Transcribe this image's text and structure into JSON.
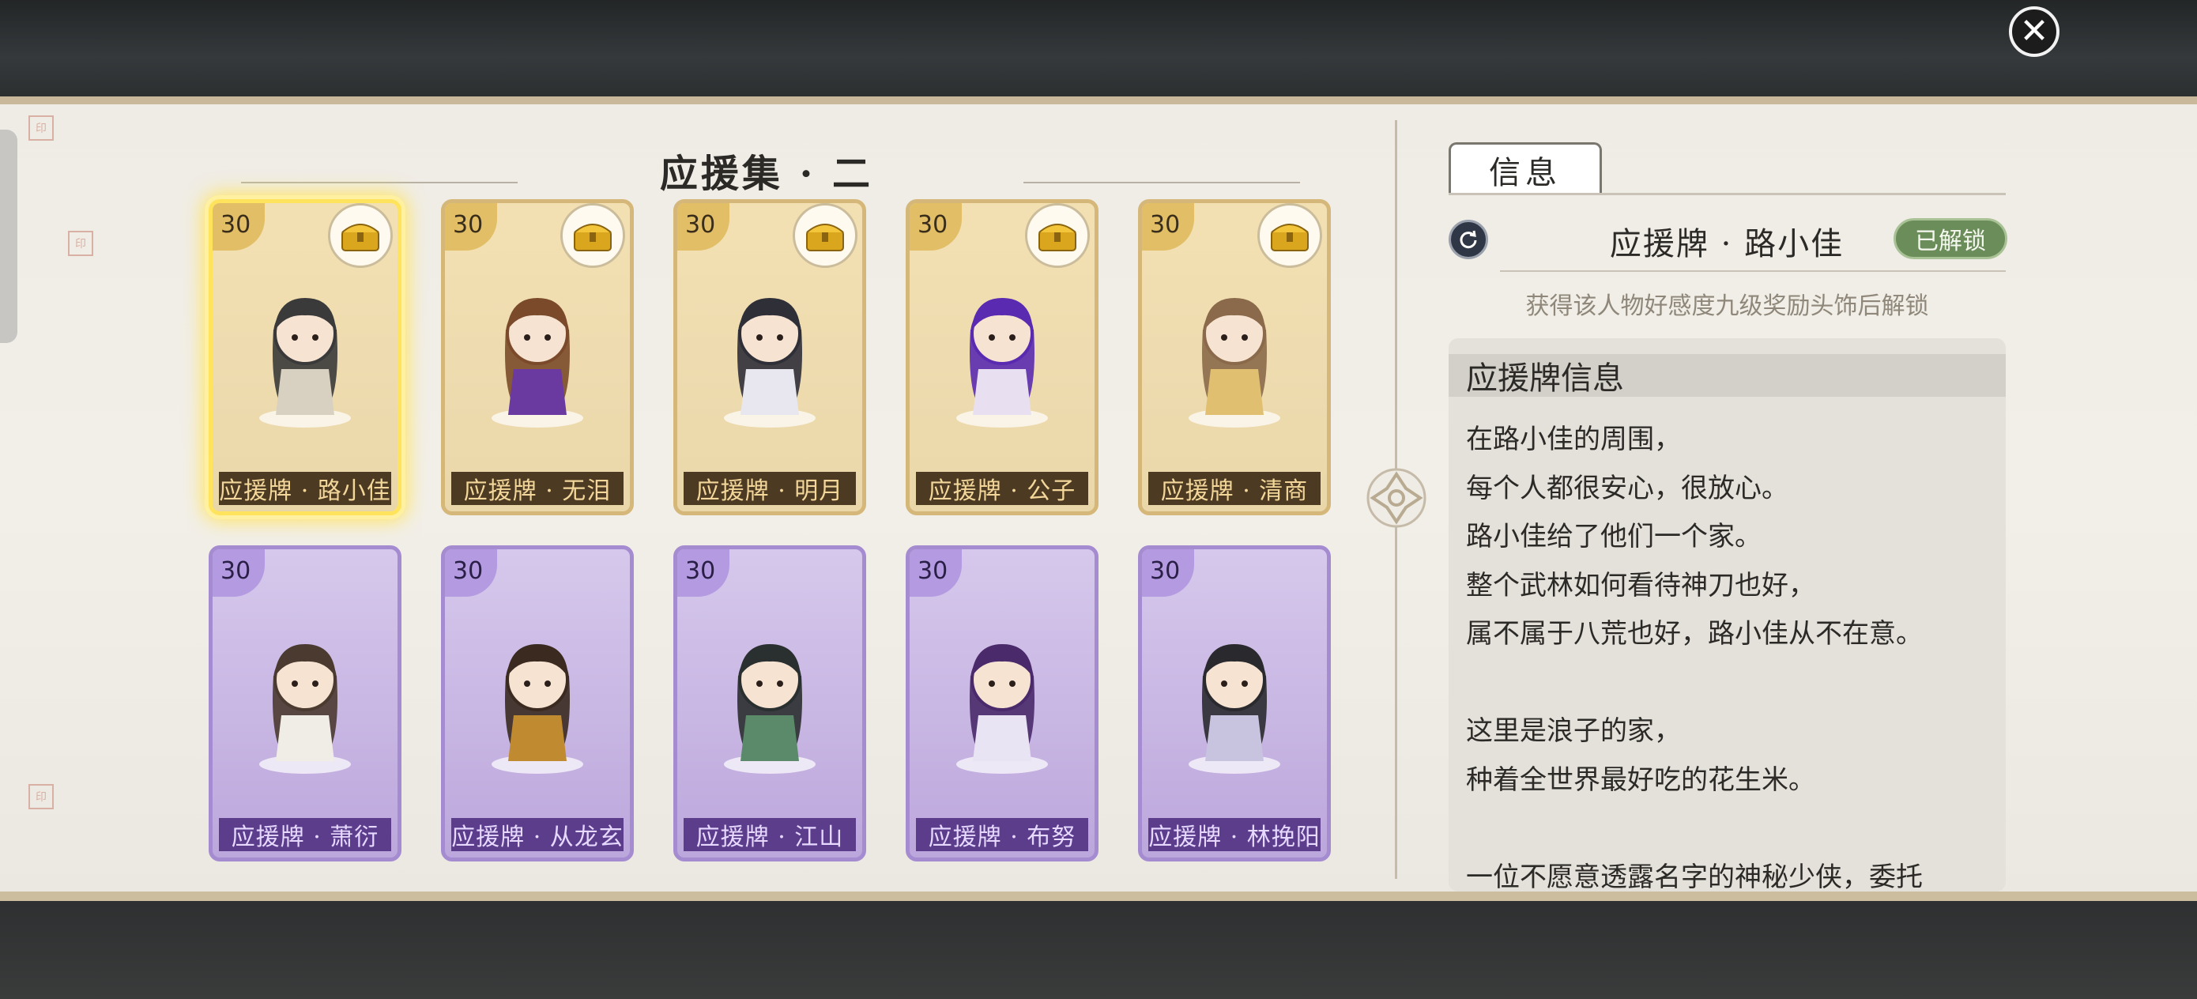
{
  "close_button": {
    "icon": "close-icon",
    "glyph": "✕"
  },
  "collection": {
    "title": "应援集 · 二",
    "cards": [
      {
        "level": "30",
        "name": "应援牌 · 路小佳",
        "rarity": "gold",
        "has_chest": true,
        "selected": true,
        "color": "#3a3a3a",
        "accent": "#d8d0c0"
      },
      {
        "level": "30",
        "name": "应援牌 · 无泪",
        "rarity": "gold",
        "has_chest": true,
        "selected": false,
        "color": "#7a4a2a",
        "accent": "#6a3aa0"
      },
      {
        "level": "30",
        "name": "应援牌 · 明月",
        "rarity": "gold",
        "has_chest": true,
        "selected": false,
        "color": "#2f2f38",
        "accent": "#e8e6ee"
      },
      {
        "level": "30",
        "name": "应援牌 · 公子",
        "rarity": "gold",
        "has_chest": true,
        "selected": false,
        "color": "#5a2ab0",
        "accent": "#e8e0f0"
      },
      {
        "level": "30",
        "name": "应援牌 · 清商",
        "rarity": "gold",
        "has_chest": true,
        "selected": false,
        "color": "#8a6a4a",
        "accent": "#e0c070"
      },
      {
        "level": "30",
        "name": "应援牌 · 萧衍",
        "rarity": "purple",
        "has_chest": false,
        "selected": false,
        "color": "#4a3a30",
        "accent": "#f0ede6"
      },
      {
        "level": "30",
        "name": "应援牌 · 从龙玄",
        "rarity": "purple",
        "has_chest": false,
        "selected": false,
        "color": "#3a2a20",
        "accent": "#c08a30"
      },
      {
        "level": "30",
        "name": "应援牌 · 江山",
        "rarity": "purple",
        "has_chest": false,
        "selected": false,
        "color": "#2a2f30",
        "accent": "#5a8a6a"
      },
      {
        "level": "30",
        "name": "应援牌 · 布努",
        "rarity": "purple",
        "has_chest": false,
        "selected": false,
        "color": "#4a2a6a",
        "accent": "#e8e4f4"
      },
      {
        "level": "30",
        "name": "应援牌 · 林挽阳",
        "rarity": "purple",
        "has_chest": false,
        "selected": false,
        "color": "#2a2a2e",
        "accent": "#c8c4e0"
      }
    ]
  },
  "info_panel": {
    "tab_label": "信息",
    "card_title": "应援牌 · 路小佳",
    "status": "已解锁",
    "unlock_hint": "获得该人物好感度九级奖励头饰后解锁",
    "section_title": "应援牌信息",
    "description_lines": [
      "在路小佳的周围，",
      "每个人都很安心，很放心。",
      "路小佳给了他们一个家。",
      "整个武林如何看待神刀也好，",
      "属不属于八荒也好，路小佳从不在意。",
      "",
      "这里是浪子的家，",
      "种着全世界最好吃的花生米。",
      "",
      "一位不愿意透露名字的神秘少侠，委托"
    ]
  },
  "colors": {
    "gold_card": "#eedcb0",
    "purple_card": "#c8b6e3",
    "selected_glow": "#ffe35c",
    "unlock_green": "#6b8d5a"
  }
}
